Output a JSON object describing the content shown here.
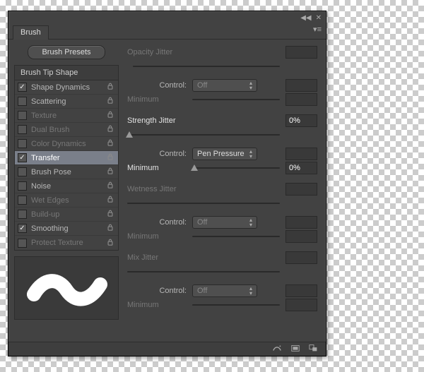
{
  "panel": {
    "tab_label": "Brush"
  },
  "left": {
    "presets_btn": "Brush Presets",
    "tip_header": "Brush Tip Shape",
    "options": [
      {
        "label": "Shape Dynamics",
        "checked": true,
        "dim": false,
        "locked": true,
        "selected": false
      },
      {
        "label": "Scattering",
        "checked": false,
        "dim": false,
        "locked": true,
        "selected": false
      },
      {
        "label": "Texture",
        "checked": false,
        "dim": true,
        "locked": true,
        "selected": false
      },
      {
        "label": "Dual Brush",
        "checked": false,
        "dim": true,
        "locked": true,
        "selected": false
      },
      {
        "label": "Color Dynamics",
        "checked": false,
        "dim": true,
        "locked": true,
        "selected": false
      },
      {
        "label": "Transfer",
        "checked": true,
        "dim": false,
        "locked": true,
        "selected": true
      },
      {
        "label": "Brush Pose",
        "checked": false,
        "dim": false,
        "locked": true,
        "selected": false
      },
      {
        "label": "Noise",
        "checked": false,
        "dim": false,
        "locked": true,
        "selected": false
      },
      {
        "label": "Wet Edges",
        "checked": false,
        "dim": true,
        "locked": true,
        "selected": false
      },
      {
        "label": "Build-up",
        "checked": false,
        "dim": true,
        "locked": true,
        "selected": false
      },
      {
        "label": "Smoothing",
        "checked": true,
        "dim": false,
        "locked": true,
        "selected": false
      },
      {
        "label": "Protect Texture",
        "checked": false,
        "dim": true,
        "locked": true,
        "selected": false
      }
    ]
  },
  "labels": {
    "opacity_jitter": "Opacity Jitter",
    "strength_jitter": "Strength Jitter",
    "wetness_jitter": "Wetness Jitter",
    "mix_jitter": "Mix Jitter",
    "control": "Control:",
    "minimum": "Minimum"
  },
  "controls": {
    "opacity_control": "Off",
    "strength_control": "Pen Pressure",
    "wetness_control": "Off",
    "mix_control": "Off"
  },
  "values": {
    "opacity_jitter": "",
    "opacity_min": "",
    "strength_jitter": "0%",
    "strength_min": "0%",
    "wetness_jitter": "",
    "wetness_min": "",
    "mix_jitter": "",
    "mix_min": ""
  }
}
